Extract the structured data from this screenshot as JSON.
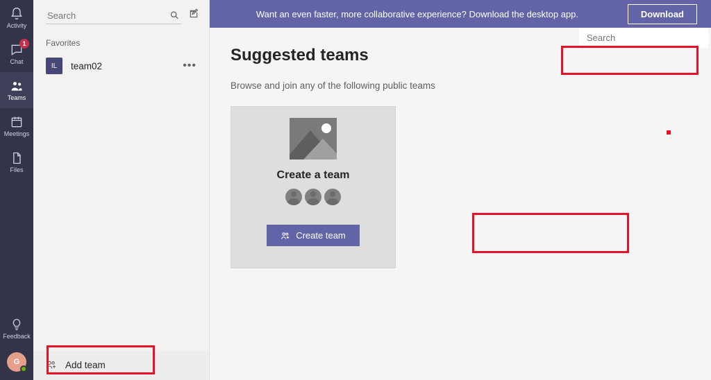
{
  "rail": {
    "activity": "Activity",
    "chat": "Chat",
    "chat_badge": "1",
    "teams": "Teams",
    "meetings": "Meetings",
    "files": "Files",
    "feedback": "Feedback",
    "user_initial": "G"
  },
  "side": {
    "search_placeholder": "Search",
    "favorites_label": "Favorites",
    "team_avatar_initials": "IL",
    "team_name": "team02",
    "add_team_label": "Add team"
  },
  "promo": {
    "text": "Want an even faster, more collaborative experience? Download the desktop app.",
    "button": "Download"
  },
  "page": {
    "title": "Suggested teams",
    "subtitle": "Browse and join any of the following public teams",
    "search_placeholder": "Search",
    "card_title": "Create a team",
    "create_button": "Create team"
  }
}
